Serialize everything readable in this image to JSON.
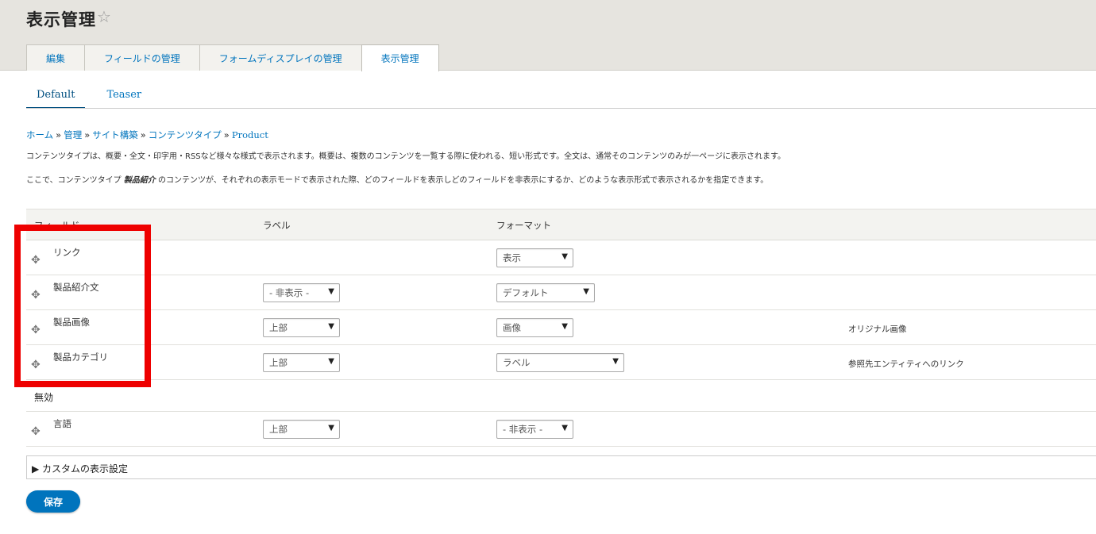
{
  "page": {
    "title": "表示管理",
    "star_icon": "☆"
  },
  "tabs": [
    {
      "label": "編集"
    },
    {
      "label": "フィールドの管理"
    },
    {
      "label": "フォームディスプレイの管理"
    },
    {
      "label": "表示管理",
      "active": true
    }
  ],
  "subtabs": [
    {
      "label": "Default",
      "active": true
    },
    {
      "label": "Teaser"
    }
  ],
  "breadcrumb": {
    "items": [
      "ホーム",
      "管理",
      "サイト構築",
      "コンテンツタイプ"
    ],
    "separator": "»",
    "current": "Product"
  },
  "description": {
    "line1": "コンテンツタイプは、概要・全文・印字用・RSSなど様々な様式で表示されます。概要は、複数のコンテンツを一覧する際に使われる、短い形式です。全文は、通常そのコンテンツのみが一ページに表示されます。",
    "line2_before": "ここで、コンテンツタイプ ",
    "line2_type": "製品紹介",
    "line2_after": " のコンテンツが、それぞれの表示モードで表示された際、どのフィールドを表示しどのフィールドを非表示にするか、どのような表示形式で表示されるかを指定できます。"
  },
  "table": {
    "columns": {
      "field": "フィールド",
      "label": "ラベル",
      "format": "フォーマット"
    },
    "rows": [
      {
        "name": "リンク",
        "label": "",
        "format": "表示",
        "extra": ""
      },
      {
        "name": "製品紹介文",
        "label": "- 非表示 -",
        "format": "デフォルト",
        "extra": ""
      },
      {
        "name": "製品画像",
        "label": "上部",
        "format": "画像",
        "extra": "オリジナル画像"
      },
      {
        "name": "製品カテゴリ",
        "label": "上部",
        "format": "ラベル",
        "extra": "参照先エンティティへのリンク"
      }
    ],
    "disabled_section": "無効",
    "disabled_rows": [
      {
        "name": "言語",
        "label": "上部",
        "format": "- 非表示 -"
      }
    ],
    "select_arrow": "▼",
    "drag_icon": "✥"
  },
  "custom_settings": {
    "label": "▶ カスタムの表示設定"
  },
  "actions": {
    "save": "保存"
  },
  "colors": {
    "link": "#0074bd",
    "highlight": "#ee0000",
    "button": "#0074bd"
  }
}
